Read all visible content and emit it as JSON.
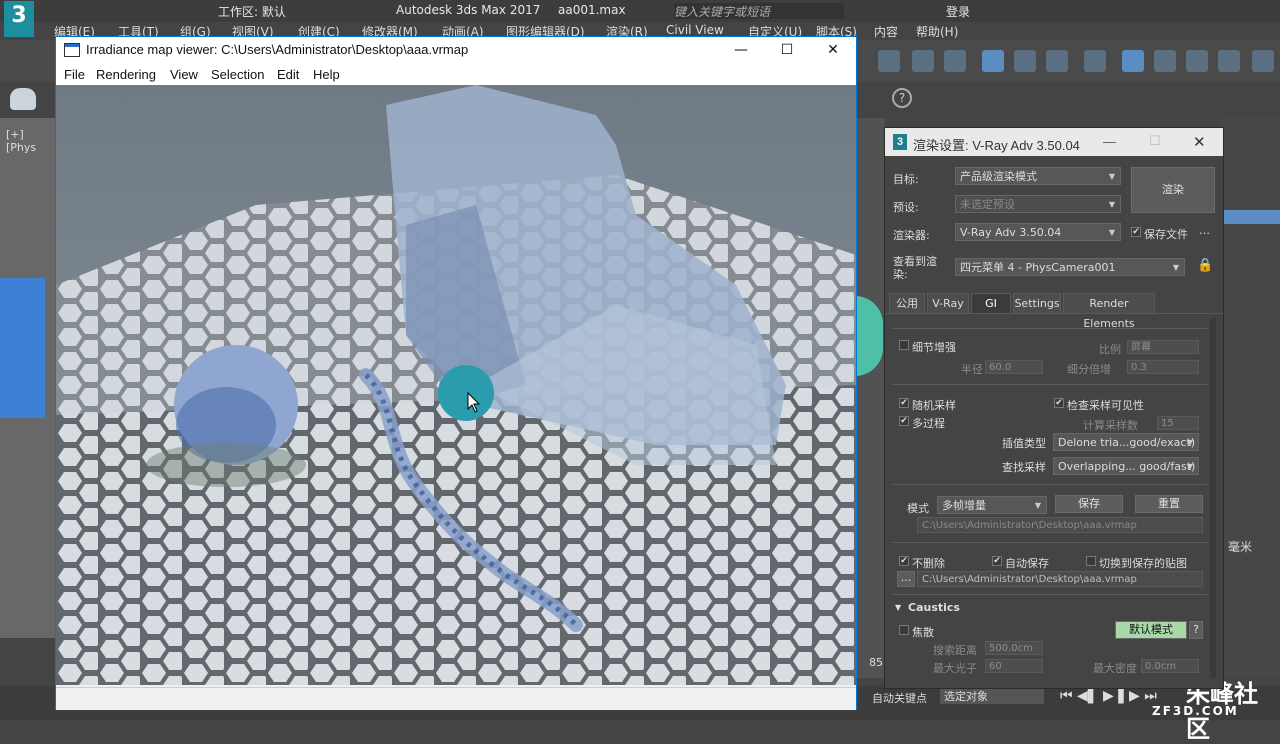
{
  "max": {
    "title": "Autodesk 3ds Max 2017",
    "file": "aa001.max",
    "workspace": "工作区: 默认",
    "search_placeholder": "键入关键字或短语",
    "login": "登录",
    "menu": [
      "编辑(E)",
      "工具(T)",
      "组(G)",
      "视图(V)",
      "创建(C)",
      "修改器(M)",
      "动画(A)",
      "图形编辑器(D)",
      "渲染(R)",
      "Civil View",
      "自定义(U)",
      "脚本(S)",
      "内容",
      "帮助(H)"
    ],
    "viewport_label": "[+] [Phys",
    "status_autokey": "自动关键点",
    "status_select": "选定对象",
    "frame_number": "85",
    "unit_label": "毫米",
    "watermark": "朱峰社区",
    "watermark_url": "ZF3D.COM"
  },
  "irradiance": {
    "title": "Irradiance map viewer: C:\\Users\\Administrator\\Desktop\\aaa.vrmap",
    "menu": [
      "File",
      "Rendering",
      "View",
      "Selection",
      "Edit",
      "Help"
    ],
    "min_glyph": "—",
    "max_glyph": "☐",
    "close_glyph": "✕"
  },
  "render_settings": {
    "title": "渲染设置: V-Ray Adv 3.50.04",
    "target_label": "目标:",
    "target_value": "产品级渲染模式",
    "preset_label": "预设:",
    "preset_value": "未选定预设",
    "renderer_label": "渲染器:",
    "renderer_value": "V-Ray Adv 3.50.04",
    "save_file": "保存文件",
    "view_label": "查看到渲染:",
    "view_value": "四元菜单 4 - PhysCamera001",
    "render_button": "渲染",
    "tabs": [
      "公用",
      "V-Ray",
      "GI",
      "Settings",
      "Render Elements"
    ],
    "active_tab": "GI",
    "detail_enhance": "细节增强",
    "scale_label": "比例",
    "scale_value": "屏幕",
    "radius_label": "半径",
    "radius_value": "60.0",
    "subdiv_mult_label": "细分倍增",
    "subdiv_mult_value": "0.3",
    "random_sample": "随机采样",
    "check_visibility": "检查采样可见性",
    "multipass": "多过程",
    "calc_samples_label": "计算采样数",
    "calc_samples_value": "15",
    "interp_type_label": "插值类型",
    "interp_type_value": "Delone tria...good/exact)",
    "lookup_label": "查找采样",
    "lookup_value": "Overlapping... good/fast)",
    "mode_label": "模式",
    "mode_value": "多帧增量",
    "save_button": "保存",
    "reset_button": "重置",
    "map_path": "C:\\Users\\Administrator\\Desktop\\aaa.vrmap",
    "dont_delete": "不删除",
    "auto_save": "自动保存",
    "switch_to_saved": "切换到保存的贴图",
    "browse_button": "...",
    "auto_save_path": "C:\\Users\\Administrator\\Desktop\\aaa.vrmap",
    "caustics_title": "Caustics",
    "caustics_label": "焦散",
    "default_mode_button": "默认模式",
    "help_button": "?",
    "search_dist_label": "搜索距离",
    "search_dist_value": "500.0cm",
    "max_photons_label": "最大光子",
    "max_photons_value": "60",
    "max_density_label": "最大密度",
    "max_density_value": "0.0cm"
  },
  "colors": {
    "accent": "#5b8cc2",
    "window_border": "#0078d7",
    "default_mode_btn": "#a8d8a8"
  }
}
